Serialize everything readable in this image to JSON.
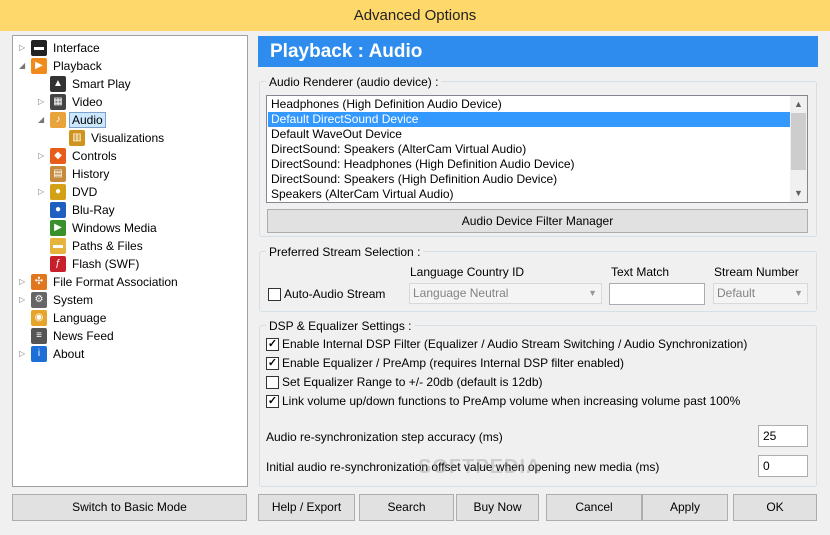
{
  "window": {
    "title": "Advanced Options"
  },
  "tree": [
    {
      "label": "Interface",
      "level": 0,
      "expander": "▷",
      "icon": "monitor-icon",
      "color": "#222222",
      "glyph": "▬"
    },
    {
      "label": "Playback",
      "level": 0,
      "expander": "◢",
      "icon": "play-icon",
      "color": "#f08a1c",
      "glyph": "▶"
    },
    {
      "label": "Smart Play",
      "level": 1,
      "expander": "",
      "icon": "graduation-cap-icon",
      "color": "#333333",
      "glyph": "▲"
    },
    {
      "label": "Video",
      "level": 1,
      "expander": "▷",
      "icon": "clapperboard-icon",
      "color": "#444444",
      "glyph": "▦"
    },
    {
      "label": "Audio",
      "level": 1,
      "expander": "◢",
      "icon": "music-note-icon",
      "color": "#e8a33a",
      "glyph": "♪",
      "selected": true
    },
    {
      "label": "Visualizations",
      "level": 2,
      "expander": "",
      "icon": "bars-icon",
      "color": "#d0931e",
      "glyph": "▥"
    },
    {
      "label": "Controls",
      "level": 1,
      "expander": "▷",
      "icon": "controls-icon",
      "color": "#e85c1a",
      "glyph": "◆"
    },
    {
      "label": "History",
      "level": 1,
      "expander": "",
      "icon": "history-icon",
      "color": "#c58a3a",
      "glyph": "▤"
    },
    {
      "label": "DVD",
      "level": 1,
      "expander": "▷",
      "icon": "dvd-icon",
      "color": "#d4a017",
      "glyph": "●"
    },
    {
      "label": "Blu-Ray",
      "level": 1,
      "expander": "",
      "icon": "bluray-icon",
      "color": "#1f5fbf",
      "glyph": "●"
    },
    {
      "label": "Windows Media",
      "level": 1,
      "expander": "",
      "icon": "windows-media-icon",
      "color": "#3a8f2d",
      "glyph": "▶"
    },
    {
      "label": "Paths & Files",
      "level": 1,
      "expander": "",
      "icon": "folder-icon",
      "color": "#e6b43c",
      "glyph": "▬"
    },
    {
      "label": "Flash (SWF)",
      "level": 1,
      "expander": "",
      "icon": "flash-icon",
      "color": "#c8202a",
      "glyph": "ƒ"
    },
    {
      "label": "File Format Association",
      "level": 0,
      "expander": "▷",
      "icon": "file-association-icon",
      "color": "#e0761e",
      "glyph": "✣"
    },
    {
      "label": "System",
      "level": 0,
      "expander": "▷",
      "icon": "gear-icon",
      "color": "#666666",
      "glyph": "⚙"
    },
    {
      "label": "Language",
      "level": 0,
      "expander": "",
      "icon": "language-icon",
      "color": "#e6a52a",
      "glyph": "◉"
    },
    {
      "label": "News Feed",
      "level": 0,
      "expander": "",
      "icon": "news-icon",
      "color": "#555555",
      "glyph": "≡"
    },
    {
      "label": "About",
      "level": 0,
      "expander": "▷",
      "icon": "info-icon",
      "color": "#1d6fd8",
      "glyph": "i"
    }
  ],
  "header": {
    "title": "Playback : Audio",
    "color": "#2d8cee"
  },
  "renderer": {
    "legend": "Audio Renderer (audio device) :",
    "devices": [
      "Headphones (High Definition Audio Device)",
      "Default DirectSound Device",
      "Default WaveOut Device",
      "DirectSound: Speakers (AlterCam Virtual Audio)",
      "DirectSound: Headphones (High Definition Audio Device)",
      "DirectSound: Speakers (High Definition Audio Device)",
      "Speakers (AlterCam Virtual Audio)"
    ],
    "selected_index": 1,
    "filter_button": "Audio Device Filter Manager"
  },
  "stream": {
    "legend": "Preferred Stream Selection :",
    "col_language": "Language Country ID",
    "col_text": "Text Match",
    "col_stream": "Stream Number",
    "auto_label": "Auto-Audio Stream",
    "auto_checked": false,
    "language_value": "Language Neutral",
    "text_value": "",
    "stream_value": "Default"
  },
  "dsp": {
    "legend": "DSP & Equalizer Settings :",
    "options": [
      {
        "label": "Enable Internal DSP Filter (Equalizer / Audio Stream Switching / Audio Synchronization)",
        "checked": true
      },
      {
        "label": "Enable Equalizer / PreAmp (requires Internal DSP filter enabled)",
        "checked": true
      },
      {
        "label": "Set Equalizer Range to +/- 20db (default is 12db)",
        "checked": false
      },
      {
        "label": "Link volume up/down functions to PreAmp volume when increasing volume past 100%",
        "checked": true
      }
    ],
    "resync_label": "Audio re-synchronization step accuracy (ms)",
    "resync_value": "25",
    "offset_label": "Initial audio re-synchronization offset value when opening new media (ms)",
    "offset_value": "0"
  },
  "buttons": {
    "basic_mode": "Switch to Basic Mode",
    "help": "Help / Export",
    "search": "Search",
    "buy": "Buy Now",
    "cancel": "Cancel",
    "apply": "Apply",
    "ok": "OK"
  },
  "watermark": "SOFTPEDIA"
}
